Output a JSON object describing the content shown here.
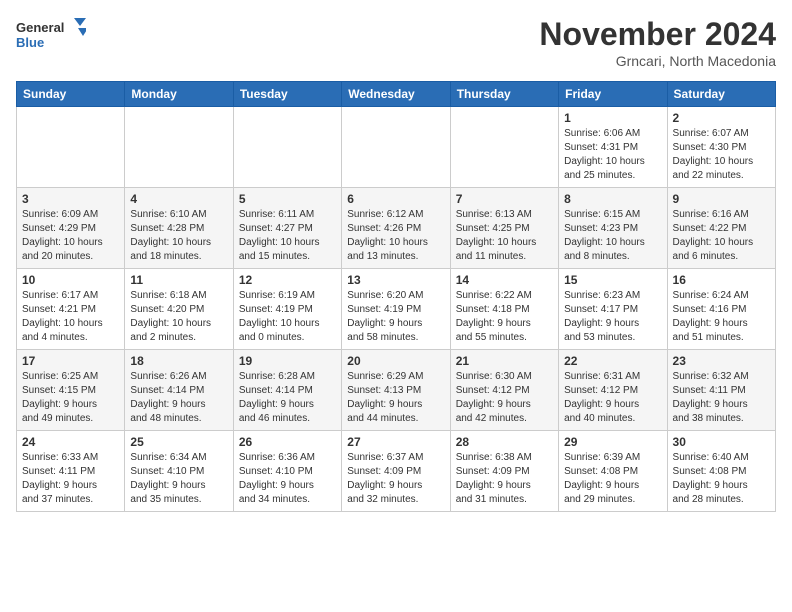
{
  "logo": {
    "general": "General",
    "blue": "Blue"
  },
  "title": "November 2024",
  "location": "Grncari, North Macedonia",
  "days_of_week": [
    "Sunday",
    "Monday",
    "Tuesday",
    "Wednesday",
    "Thursday",
    "Friday",
    "Saturday"
  ],
  "weeks": [
    [
      {
        "day": "",
        "info": ""
      },
      {
        "day": "",
        "info": ""
      },
      {
        "day": "",
        "info": ""
      },
      {
        "day": "",
        "info": ""
      },
      {
        "day": "",
        "info": ""
      },
      {
        "day": "1",
        "info": "Sunrise: 6:06 AM\nSunset: 4:31 PM\nDaylight: 10 hours\nand 25 minutes."
      },
      {
        "day": "2",
        "info": "Sunrise: 6:07 AM\nSunset: 4:30 PM\nDaylight: 10 hours\nand 22 minutes."
      }
    ],
    [
      {
        "day": "3",
        "info": "Sunrise: 6:09 AM\nSunset: 4:29 PM\nDaylight: 10 hours\nand 20 minutes."
      },
      {
        "day": "4",
        "info": "Sunrise: 6:10 AM\nSunset: 4:28 PM\nDaylight: 10 hours\nand 18 minutes."
      },
      {
        "day": "5",
        "info": "Sunrise: 6:11 AM\nSunset: 4:27 PM\nDaylight: 10 hours\nand 15 minutes."
      },
      {
        "day": "6",
        "info": "Sunrise: 6:12 AM\nSunset: 4:26 PM\nDaylight: 10 hours\nand 13 minutes."
      },
      {
        "day": "7",
        "info": "Sunrise: 6:13 AM\nSunset: 4:25 PM\nDaylight: 10 hours\nand 11 minutes."
      },
      {
        "day": "8",
        "info": "Sunrise: 6:15 AM\nSunset: 4:23 PM\nDaylight: 10 hours\nand 8 minutes."
      },
      {
        "day": "9",
        "info": "Sunrise: 6:16 AM\nSunset: 4:22 PM\nDaylight: 10 hours\nand 6 minutes."
      }
    ],
    [
      {
        "day": "10",
        "info": "Sunrise: 6:17 AM\nSunset: 4:21 PM\nDaylight: 10 hours\nand 4 minutes."
      },
      {
        "day": "11",
        "info": "Sunrise: 6:18 AM\nSunset: 4:20 PM\nDaylight: 10 hours\nand 2 minutes."
      },
      {
        "day": "12",
        "info": "Sunrise: 6:19 AM\nSunset: 4:19 PM\nDaylight: 10 hours\nand 0 minutes."
      },
      {
        "day": "13",
        "info": "Sunrise: 6:20 AM\nSunset: 4:19 PM\nDaylight: 9 hours\nand 58 minutes."
      },
      {
        "day": "14",
        "info": "Sunrise: 6:22 AM\nSunset: 4:18 PM\nDaylight: 9 hours\nand 55 minutes."
      },
      {
        "day": "15",
        "info": "Sunrise: 6:23 AM\nSunset: 4:17 PM\nDaylight: 9 hours\nand 53 minutes."
      },
      {
        "day": "16",
        "info": "Sunrise: 6:24 AM\nSunset: 4:16 PM\nDaylight: 9 hours\nand 51 minutes."
      }
    ],
    [
      {
        "day": "17",
        "info": "Sunrise: 6:25 AM\nSunset: 4:15 PM\nDaylight: 9 hours\nand 49 minutes."
      },
      {
        "day": "18",
        "info": "Sunrise: 6:26 AM\nSunset: 4:14 PM\nDaylight: 9 hours\nand 48 minutes."
      },
      {
        "day": "19",
        "info": "Sunrise: 6:28 AM\nSunset: 4:14 PM\nDaylight: 9 hours\nand 46 minutes."
      },
      {
        "day": "20",
        "info": "Sunrise: 6:29 AM\nSunset: 4:13 PM\nDaylight: 9 hours\nand 44 minutes."
      },
      {
        "day": "21",
        "info": "Sunrise: 6:30 AM\nSunset: 4:12 PM\nDaylight: 9 hours\nand 42 minutes."
      },
      {
        "day": "22",
        "info": "Sunrise: 6:31 AM\nSunset: 4:12 PM\nDaylight: 9 hours\nand 40 minutes."
      },
      {
        "day": "23",
        "info": "Sunrise: 6:32 AM\nSunset: 4:11 PM\nDaylight: 9 hours\nand 38 minutes."
      }
    ],
    [
      {
        "day": "24",
        "info": "Sunrise: 6:33 AM\nSunset: 4:11 PM\nDaylight: 9 hours\nand 37 minutes."
      },
      {
        "day": "25",
        "info": "Sunrise: 6:34 AM\nSunset: 4:10 PM\nDaylight: 9 hours\nand 35 minutes."
      },
      {
        "day": "26",
        "info": "Sunrise: 6:36 AM\nSunset: 4:10 PM\nDaylight: 9 hours\nand 34 minutes."
      },
      {
        "day": "27",
        "info": "Sunrise: 6:37 AM\nSunset: 4:09 PM\nDaylight: 9 hours\nand 32 minutes."
      },
      {
        "day": "28",
        "info": "Sunrise: 6:38 AM\nSunset: 4:09 PM\nDaylight: 9 hours\nand 31 minutes."
      },
      {
        "day": "29",
        "info": "Sunrise: 6:39 AM\nSunset: 4:08 PM\nDaylight: 9 hours\nand 29 minutes."
      },
      {
        "day": "30",
        "info": "Sunrise: 6:40 AM\nSunset: 4:08 PM\nDaylight: 9 hours\nand 28 minutes."
      }
    ]
  ]
}
